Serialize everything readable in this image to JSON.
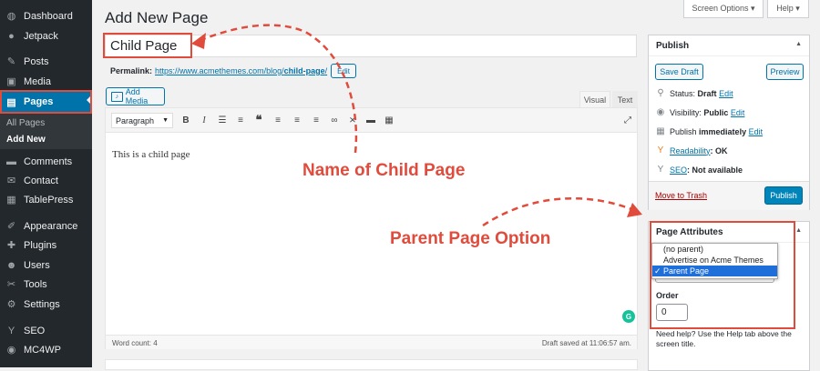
{
  "sidebar": {
    "items": [
      {
        "label": "Dashboard",
        "icon": "dashboard-icon",
        "glyph": "◍"
      },
      {
        "label": "Jetpack",
        "icon": "jetpack-icon",
        "glyph": "●"
      },
      {
        "label": "Posts",
        "icon": "pushpin-icon",
        "glyph": "✎"
      },
      {
        "label": "Media",
        "icon": "media-icon",
        "glyph": "▣"
      },
      {
        "label": "Pages",
        "icon": "pages-icon",
        "glyph": "▤"
      },
      {
        "label": "Comments",
        "icon": "comments-icon",
        "glyph": "▬"
      },
      {
        "label": "Contact",
        "icon": "contact-icon",
        "glyph": "✉"
      },
      {
        "label": "TablePress",
        "icon": "table-icon",
        "glyph": "▦"
      },
      {
        "label": "Appearance",
        "icon": "appearance-icon",
        "glyph": "✐"
      },
      {
        "label": "Plugins",
        "icon": "plugins-icon",
        "glyph": "✚"
      },
      {
        "label": "Users",
        "icon": "users-icon",
        "glyph": "☻"
      },
      {
        "label": "Tools",
        "icon": "tools-icon",
        "glyph": "✂"
      },
      {
        "label": "Settings",
        "icon": "settings-icon",
        "glyph": "⚙"
      },
      {
        "label": "SEO",
        "icon": "yoast-icon",
        "glyph": "Y"
      },
      {
        "label": "MC4WP",
        "icon": "mc4wp-icon",
        "glyph": "◉"
      }
    ],
    "submenu": [
      "All Pages",
      "Add New"
    ]
  },
  "header": {
    "title": "Add New Page",
    "screen_options": "Screen Options ▾",
    "help": "Help ▾"
  },
  "editor": {
    "title_value": "Child Page",
    "permalink_label": "Permalink:",
    "permalink_base": "https://www.acmethemes.com/blog/",
    "permalink_slug": "child-page",
    "permalink_end": "/",
    "edit_label": "Edit",
    "add_media": "Add Media",
    "tab_visual": "Visual",
    "tab_text": "Text",
    "format": "Paragraph",
    "content": "This is a child page",
    "word_count": "Word count: 4",
    "draft_saved": "Draft saved at 11:06:57 am."
  },
  "publish": {
    "heading": "Publish",
    "save_draft": "Save Draft",
    "preview": "Preview",
    "status_label": "Status:",
    "status_value": "Draft",
    "visibility_label": "Visibility:",
    "visibility_value": "Public",
    "publish_label": "Publish",
    "publish_value": "immediately",
    "readability_label": "Readability",
    "readability_value": ": OK",
    "seo_label": "SEO",
    "seo_value": ": Not available",
    "edit": "Edit",
    "trash": "Move to Trash",
    "publish_button": "Publish"
  },
  "attributes": {
    "heading": "Page Attributes",
    "options": [
      "(no parent)",
      "Advertise on Acme Themes",
      "Parent Page"
    ],
    "selected": "Parent Page",
    "check": "✓",
    "order_label": "Order",
    "order_value": "0",
    "help": "Need help? Use the Help tab above the screen title."
  },
  "annotations": {
    "child_name": "Name of Child Page",
    "parent_option": "Parent Page Option",
    "color": "#e14b3c"
  }
}
